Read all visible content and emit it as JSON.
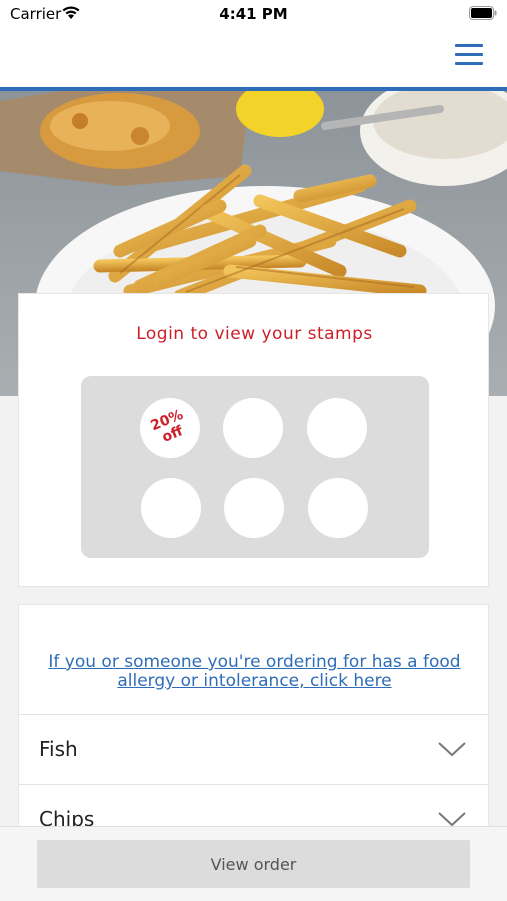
{
  "status_bar": {
    "carrier": "Carrier",
    "time": "4:41 PM"
  },
  "nav": {
    "menu_icon": "hamburger-menu-icon",
    "accent_color": "#2f6db8"
  },
  "hero": {
    "image_description_icon": "fish-and-chips-photo"
  },
  "stamp_card": {
    "title": "Login to view your stamps",
    "title_color": "#cc1f27",
    "stamps": [
      {
        "reward": "20%\noff"
      },
      {
        "reward": ""
      },
      {
        "reward": ""
      },
      {
        "reward": ""
      },
      {
        "reward": ""
      },
      {
        "reward": ""
      }
    ]
  },
  "menu": {
    "allergy_link": "If you or someone you're ordering for has a food allergy or intolerance, click here",
    "categories": [
      {
        "label": "Fish",
        "icon": "chevron-down-icon"
      },
      {
        "label": "Chips",
        "icon": "chevron-down-icon"
      }
    ]
  },
  "footer": {
    "view_order_label": "View order"
  }
}
